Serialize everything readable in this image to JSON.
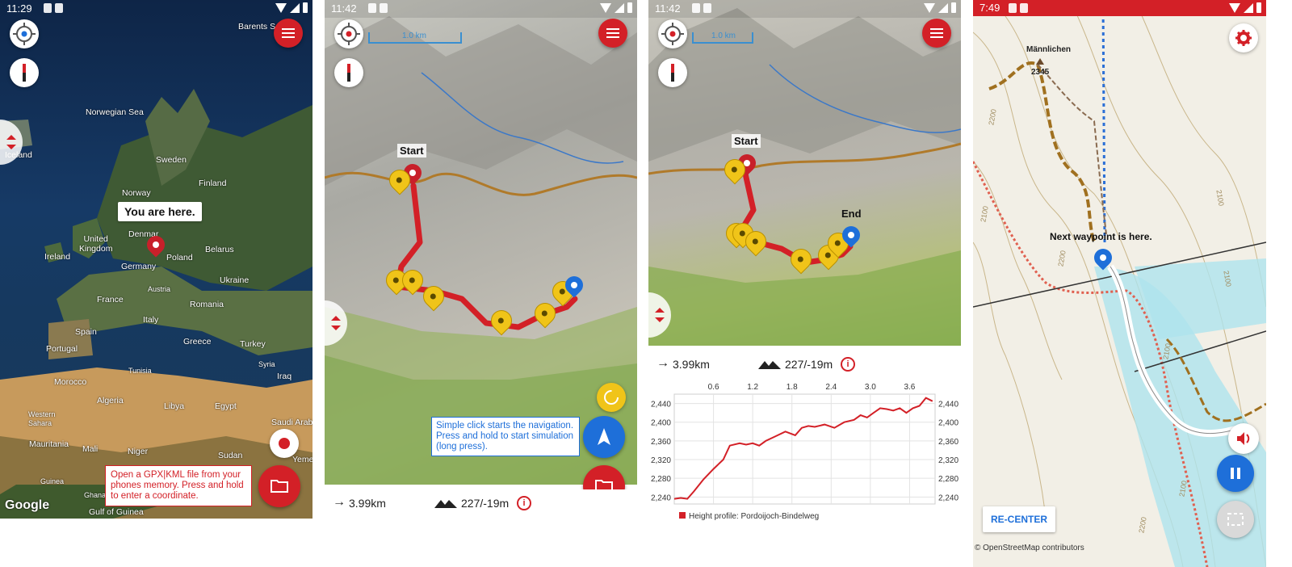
{
  "screens": [
    {
      "status_time": "11:29",
      "map_labels": {
        "barents_sea": "Barents Se",
        "norwegian_sea": "Norwegian Sea",
        "iceland": "Iceland",
        "sweden": "Sweden",
        "finland": "Finland",
        "norway": "Norway",
        "united_kingdom": "United\nKingdom",
        "ireland": "Ireland",
        "denmark": "Denmar",
        "germany": "Germany",
        "poland": "Poland",
        "belarus": "Belarus",
        "ukraine": "Ukraine",
        "austria": "Austria",
        "france": "France",
        "romania": "Romania",
        "italy": "Italy",
        "spain": "Spain",
        "portugal": "Portugal",
        "greece": "Greece",
        "turkey": "Turkey",
        "tunisia": "Tunisia",
        "syria": "Syria",
        "iraq": "Iraq",
        "morocco": "Morocco",
        "algeria": "Algeria",
        "libya": "Libya",
        "egypt": "Egypt",
        "western_sahara": "Western\nSahara",
        "saudi_arabia": "Saudi Arabi",
        "mauritania": "Mauritania",
        "mali": "Mali",
        "niger": "Niger",
        "sudan": "Sudan",
        "yemen": "Yeme",
        "guinea": "Guinea",
        "ghana": "Ghana",
        "gulf_of_guinea": "Gulf of Guinea"
      },
      "you_are_here": "You are here.",
      "tooltip": "Open a GPX|KML file from your phones memory. Press and hold to enter a coordinate.",
      "logo": "Google"
    },
    {
      "status_time": "11:42",
      "scale": "1.0 km",
      "start_label": "Start",
      "tooltip": "Simple click starts the navigation. Press and hold to start simulation (long press).",
      "distance": "3.99km",
      "elevation": "227/-19m",
      "info": "i"
    },
    {
      "status_time": "11:42",
      "scale": "1.0 km",
      "start_label": "Start",
      "end_label": "End",
      "distance": "3.99km",
      "elevation": "227/-19m",
      "info": "i"
    },
    {
      "status_time": "7:49",
      "waypoint_label": "Next waypoint is here.",
      "peak_name": "Männlichen",
      "peak_elev": "2345",
      "contour_labels": [
        "2200",
        "2100",
        "2100",
        "2100",
        "2100",
        "2200",
        "2200",
        "2100"
      ],
      "recenter": "RE-CENTER",
      "attribution": "© OpenStreetMap contributors",
      "colors": {
        "status_bar": "#d32027",
        "accent": "#1e6fd9"
      }
    }
  ],
  "chart_data": {
    "type": "line",
    "title": "",
    "xlabel": "",
    "ylabel": "",
    "x_ticks": [
      "0.6",
      "1.2",
      "1.8",
      "2.4",
      "3.0",
      "3.6"
    ],
    "y_ticks": [
      "2,440",
      "2,400",
      "2,360",
      "2,320",
      "2,280",
      "2,240"
    ],
    "xlim": [
      0,
      3.99
    ],
    "ylim": [
      2225,
      2460
    ],
    "grid": true,
    "legend_position": "bottom-left",
    "series": [
      {
        "name": "Height profile: Pordoijoch-Bindelweg",
        "color": "#d32027",
        "x": [
          0.0,
          0.1,
          0.2,
          0.3,
          0.45,
          0.6,
          0.75,
          0.85,
          1.0,
          1.1,
          1.2,
          1.3,
          1.4,
          1.55,
          1.7,
          1.85,
          1.95,
          2.05,
          2.15,
          2.3,
          2.45,
          2.6,
          2.75,
          2.85,
          2.95,
          3.05,
          3.15,
          3.25,
          3.35,
          3.45,
          3.55,
          3.65,
          3.75,
          3.85,
          3.95
        ],
        "values": [
          2236,
          2238,
          2236,
          2252,
          2278,
          2300,
          2320,
          2350,
          2355,
          2352,
          2355,
          2350,
          2360,
          2370,
          2380,
          2372,
          2388,
          2392,
          2390,
          2395,
          2388,
          2400,
          2405,
          2415,
          2410,
          2420,
          2430,
          2428,
          2425,
          2430,
          2420,
          2430,
          2435,
          2452,
          2445
        ]
      }
    ]
  }
}
